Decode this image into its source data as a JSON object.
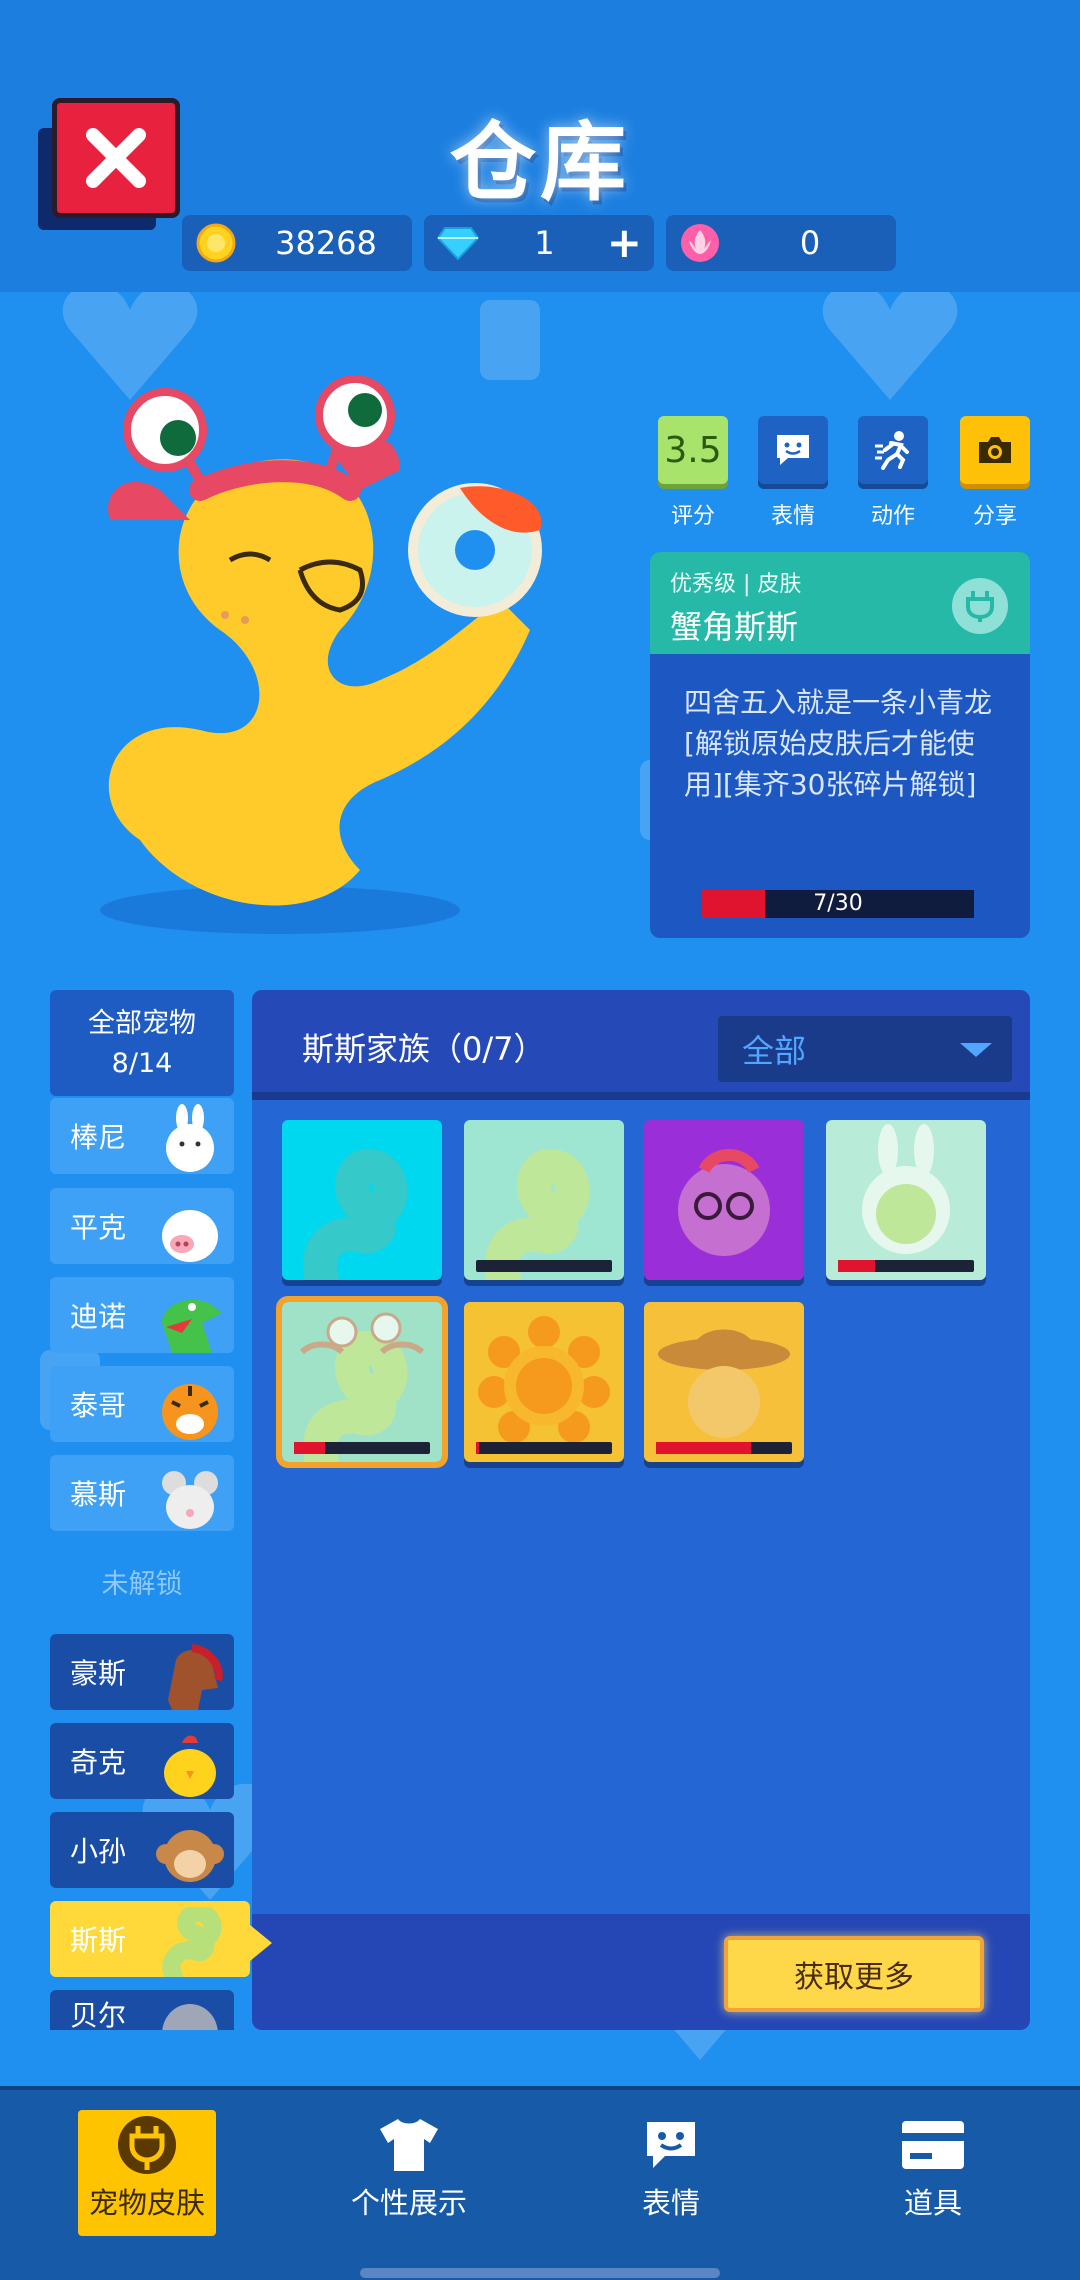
{
  "header": {
    "title": "仓库",
    "coins": "38268",
    "diamonds": "1",
    "diamond_add": "+",
    "petals": "0"
  },
  "actions": [
    {
      "label": "评分",
      "value": "3.5"
    },
    {
      "label": "表情",
      "icon": "chat-face-icon"
    },
    {
      "label": "动作",
      "icon": "running-icon"
    },
    {
      "label": "分享",
      "icon": "camera-icon"
    }
  ],
  "skin_card": {
    "tier": "优秀级 | 皮肤",
    "name": "蟹角斯斯",
    "description": "四舍五入就是一条小青龙[解锁原始皮肤后才能使用][集齐30张碎片解锁]",
    "progress_text": "7/30",
    "progress_fraction": 0.233
  },
  "sidebar": {
    "all_pets_label": "全部宠物",
    "all_pets_count": "8/14",
    "locked_divider": "未解锁",
    "pets": [
      {
        "name": "棒尼"
      },
      {
        "name": "平克"
      },
      {
        "name": "迪诺"
      },
      {
        "name": "泰哥"
      },
      {
        "name": "慕斯"
      },
      {
        "name": "豪斯"
      },
      {
        "name": "奇克"
      },
      {
        "name": "小孙"
      },
      {
        "name": "斯斯"
      },
      {
        "name": "贝尔"
      }
    ]
  },
  "grid": {
    "family_title": "斯斯家族（0/7）",
    "filter_value": "全部",
    "more_button": "获取更多",
    "skins": [
      {
        "color": "#00d8f0",
        "progress": null
      },
      {
        "color": "#9fe6d2",
        "progress": 0.0
      },
      {
        "color": "#9a2fd9",
        "progress": null
      },
      {
        "color": "#b9ecd8",
        "progress": 0.27
      },
      {
        "color": "#9fe2c8",
        "progress": 0.233,
        "selected": true
      },
      {
        "color": "#f4c232",
        "progress": 0.02
      },
      {
        "color": "#f6c03a",
        "progress": 0.7
      }
    ]
  },
  "bottom_nav": [
    {
      "label": "宠物皮肤",
      "active": true
    },
    {
      "label": "个性展示"
    },
    {
      "label": "表情"
    },
    {
      "label": "道具"
    }
  ],
  "colors": {
    "background": "#1f8ff0",
    "accent_yellow": "#ffd93a",
    "close_red": "#e8213f",
    "progress_red": "#e0142e",
    "card_teal": "#27b9a8"
  }
}
